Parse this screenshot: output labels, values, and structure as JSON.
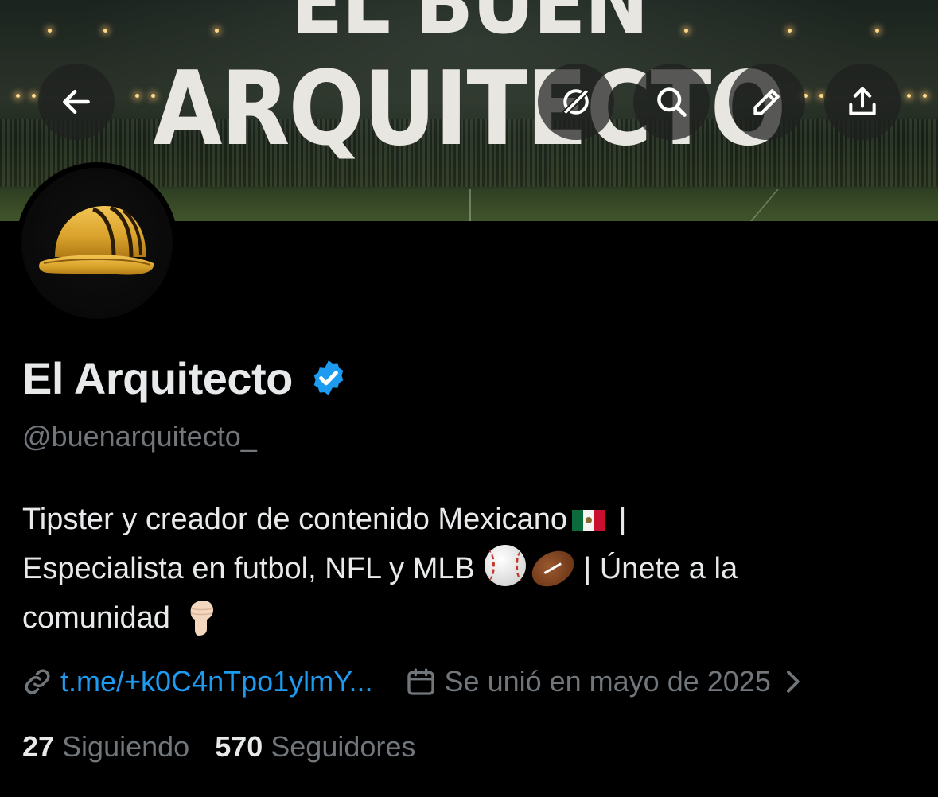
{
  "banner": {
    "title_line1": "EL BUEN",
    "title_line2": "ARQUITECTO"
  },
  "header": {
    "back_icon": "arrow-left-icon",
    "grok_icon": "grok-icon",
    "search_icon": "search-icon",
    "edit_icon": "pencil-icon",
    "share_icon": "share-upload-icon"
  },
  "profile": {
    "avatar_icon": "hard-hat-icon",
    "name": "El Arquitecto",
    "verified_icon": "verified-badge-icon",
    "verified_color": "#1d9bf0",
    "handle": "@buenarquitecto_",
    "bio": {
      "line1": "Tipster y creador de contenido Mexicano",
      "line1_end": "|",
      "line2": "Especialista en futbol, NFL y MLB",
      "line2_end": "| Únete a la",
      "line3": "comunidad"
    },
    "link": "t.me/+k0C4nTpo1ylmY...",
    "joined": "Se unió en mayo de 2025",
    "following_count": "27",
    "following_label": "Siguiendo",
    "followers_count": "570",
    "followers_label": "Seguidores"
  },
  "colors": {
    "background": "#000000",
    "text_primary": "#e7e9ea",
    "text_secondary": "#71767b",
    "link": "#1d9bf0"
  }
}
